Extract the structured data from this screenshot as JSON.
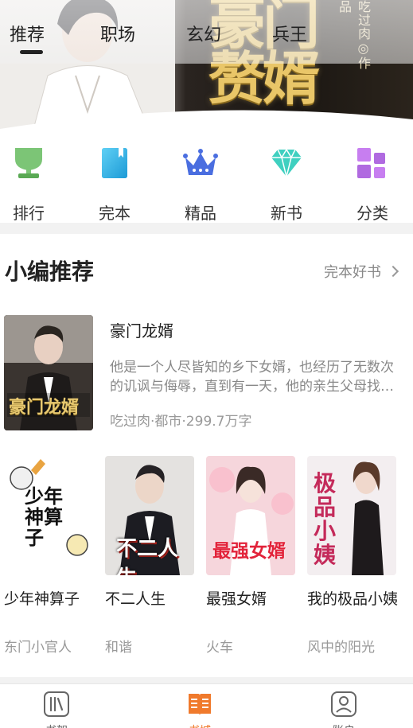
{
  "banner": {
    "title": "豪门赘婿",
    "author_line": "吃过肉◎作品",
    "dots": 5,
    "active_dot": 0
  },
  "top_tabs": [
    "推荐",
    "职场",
    "玄幻",
    "兵王"
  ],
  "active_tab": 0,
  "categories": [
    {
      "label": "排行",
      "icon": "trophy-icon"
    },
    {
      "label": "完本",
      "icon": "book-icon"
    },
    {
      "label": "精品",
      "icon": "crown-icon"
    },
    {
      "label": "新书",
      "icon": "diamond-icon"
    },
    {
      "label": "分类",
      "icon": "grid-icon"
    }
  ],
  "section": {
    "title": "小编推荐",
    "more_label": "完本好书"
  },
  "featured": {
    "cover_text": "豪门龙婿",
    "title": "豪门龙婿",
    "description": "他是一个人尽皆知的乡下女婿，也经历了无数次的讥讽与侮辱，直到有一天，他的亲生父母找…",
    "meta": "吃过肉·都市·299.7万字"
  },
  "books": [
    {
      "title": "少年神算子",
      "author": "东门小官人",
      "cover_text": "少年神算子"
    },
    {
      "title": "不二人生",
      "author": "和谐",
      "cover_text": "不二人生"
    },
    {
      "title": "最强女婿",
      "author": "火车",
      "cover_text": "最强女婿"
    },
    {
      "title": "我的极品小姨",
      "author": "风中的阳光",
      "cover_text": "极品小姨"
    }
  ],
  "bottom_nav": [
    {
      "label": "书架",
      "icon": "bookshelf-icon"
    },
    {
      "label": "书城",
      "icon": "bookstore-icon"
    },
    {
      "label": "账户",
      "icon": "account-icon"
    }
  ],
  "active_nav": 1,
  "colors": {
    "accent": "#f07a2c",
    "banner_gold": "#e9c668"
  }
}
